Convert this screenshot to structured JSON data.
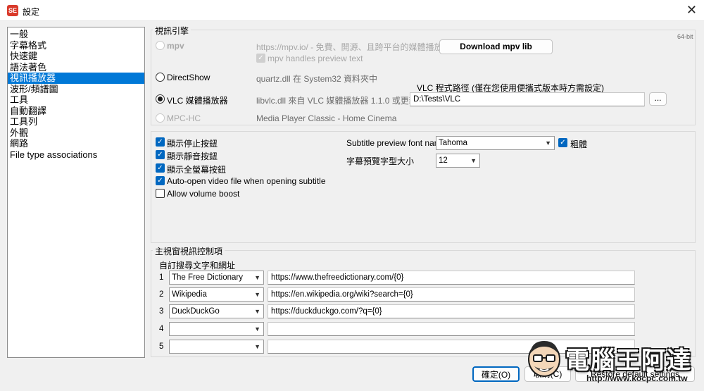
{
  "window": {
    "title": "設定",
    "app_icon_text": "SE"
  },
  "sidebar": {
    "items": [
      {
        "label": "一般"
      },
      {
        "label": "字幕格式"
      },
      {
        "label": "快速鍵"
      },
      {
        "label": "語法著色"
      },
      {
        "label": "視訊播放器",
        "selected": true
      },
      {
        "label": "波形/頻譜圖"
      },
      {
        "label": "工具"
      },
      {
        "label": "自動翻譯"
      },
      {
        "label": "工具列"
      },
      {
        "label": "外觀"
      },
      {
        "label": "網路"
      },
      {
        "label": "File type associations"
      }
    ]
  },
  "video_engine": {
    "legend": "視訊引擎",
    "badge": "64-bit",
    "mpv": {
      "label": "mpv",
      "desc": "https://mpv.io/ - 免費、開源、且跨平台的媒體播放器",
      "download_label": "Download mpv lib",
      "preview_checkbox": "mpv handles preview text"
    },
    "directshow": {
      "label": "DirectShow",
      "desc": "quartz.dll 在 System32 資料夾中"
    },
    "vlc": {
      "label": "VLC 媒體播放器",
      "desc": "libvlc.dll 來自 VLC 媒體播放器 1.1.0 或更新",
      "path_label": "VLC 程式路徑 (僅在您使用便攜式版本時方需設定)",
      "path_value": "D:\\Tests\\VLC",
      "browse_label": "..."
    },
    "mpchc": {
      "label": "MPC-HC",
      "desc": "Media Player Classic - Home Cinema"
    }
  },
  "options": {
    "show_stop": "顯示停止按鈕",
    "show_mute": "顯示靜音按鈕",
    "show_fullscreen": "顯示全螢幕按鈕",
    "auto_open": "Auto-open video file when opening subtitle",
    "volume_boost": "Allow volume boost",
    "font_name_label": "Subtitle preview font name",
    "font_name_value": "Tahoma",
    "bold_label": "粗體",
    "font_size_label": "字幕預覽字型大小",
    "font_size_value": "12"
  },
  "main_controls": {
    "legend": "主視窗視訊控制項",
    "sub_label": "自訂搜尋文字和網址",
    "rows": [
      {
        "num": "1",
        "name": "The Free Dictionary",
        "url": "https://www.thefreedictionary.com/{0}"
      },
      {
        "num": "2",
        "name": "Wikipedia",
        "url": "https://en.wikipedia.org/wiki?search={0}"
      },
      {
        "num": "3",
        "name": "DuckDuckGo",
        "url": "https://duckduckgo.com/?q={0}"
      },
      {
        "num": "4",
        "name": "",
        "url": ""
      },
      {
        "num": "5",
        "name": "",
        "url": ""
      }
    ]
  },
  "buttons": {
    "ok": "確定(O)",
    "cancel": "取消(C)",
    "restore": "Restore default settings"
  },
  "watermark": {
    "text": "電腦王阿達",
    "url": "http://www.kocpc.com.tw"
  }
}
